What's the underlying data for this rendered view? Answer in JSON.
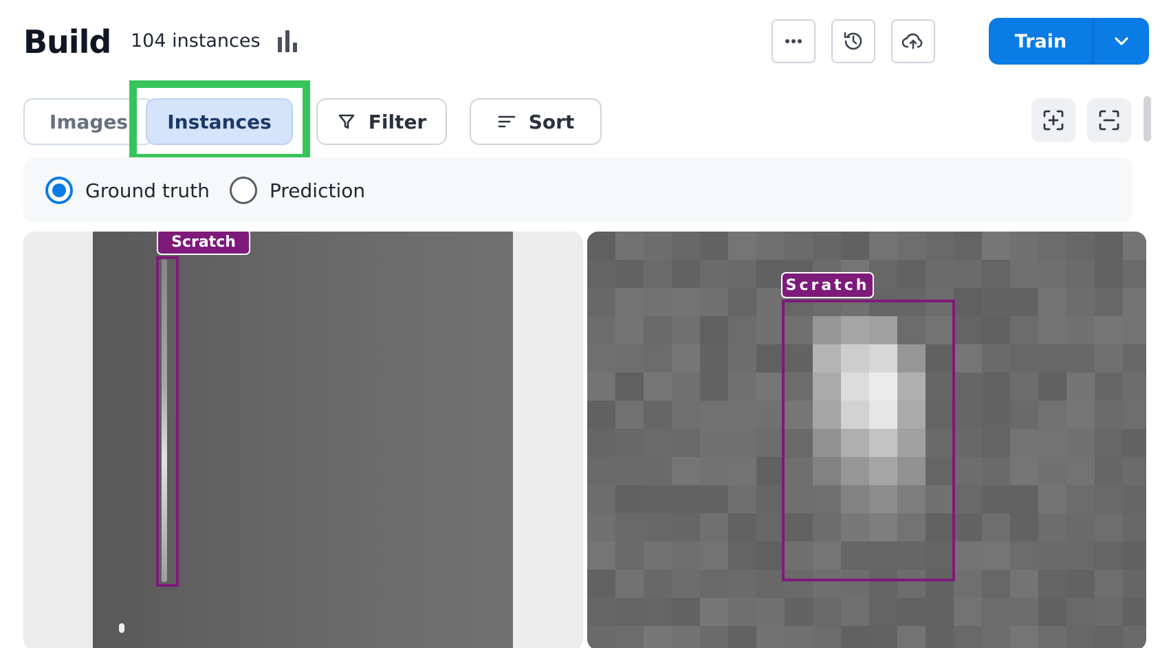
{
  "header": {
    "title": "Build",
    "instance_count": "104 instances",
    "icons": [
      "bar-chart-icon",
      "more-icon",
      "history-icon",
      "cloud-upload-icon",
      "chevron-down-icon"
    ],
    "train_label": "Train",
    "accent_color": "#0b7be6"
  },
  "tabs": [
    {
      "label": "Images",
      "selected": false
    },
    {
      "label": "Instances",
      "selected": true
    }
  ],
  "toolbar": {
    "filter_label": "Filter",
    "sort_label": "Sort",
    "icons": [
      "filter-icon",
      "sort-icon",
      "zoom-in-frame-icon",
      "zoom-out-frame-icon"
    ]
  },
  "view_mode": {
    "options": [
      {
        "label": "Ground truth",
        "selected": true
      },
      {
        "label": "Prediction",
        "selected": false
      }
    ]
  },
  "instances": [
    {
      "label": "Scratch",
      "label_color": "#7d1a7a"
    },
    {
      "label": "Scratch",
      "label_color": "#7d1a7a"
    }
  ]
}
